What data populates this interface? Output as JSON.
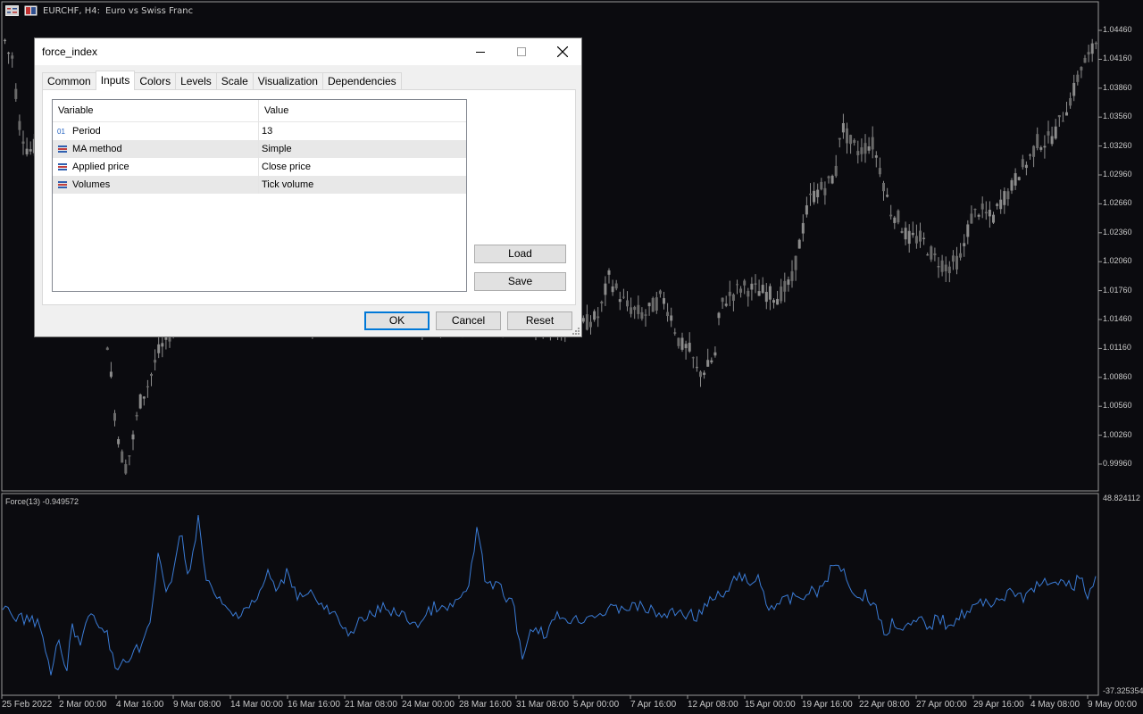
{
  "chart": {
    "symbol_label": "EURCHF, H4:",
    "description": "Euro vs Swiss Franc",
    "price_labels": [
      "1.04460",
      "1.04160",
      "1.03860",
      "1.03560",
      "1.03260",
      "1.02960",
      "1.02660",
      "1.02360",
      "1.02060",
      "1.01760",
      "1.01460",
      "1.01160",
      "1.00860",
      "1.00560",
      "1.00260",
      "0.99960"
    ],
    "date_labels": [
      "25 Feb 2022",
      "2 Mar 00:00",
      "4 Mar 16:00",
      "9 Mar 08:00",
      "14 Mar 00:00",
      "16 Mar 16:00",
      "21 Mar 08:00",
      "24 Mar 00:00",
      "28 Mar 16:00",
      "31 Mar 08:00",
      "5 Apr 00:00",
      "7 Apr 16:00",
      "12 Apr 08:00",
      "15 Apr 00:00",
      "19 Apr 16:00",
      "22 Apr 08:00",
      "27 Apr 00:00",
      "29 Apr 16:00",
      "4 May 08:00",
      "9 May 00:00"
    ],
    "indicator_title": "Force(13) -0.949572",
    "osc_max_label": "48.824112",
    "osc_min_label": "-37.325354",
    "colors": {
      "background": "#0b0b0f",
      "candle": "#8c8c8c",
      "force_line": "#3a7bd5",
      "grid_border": "#9a9a9a"
    }
  },
  "dialog": {
    "title": "force_index",
    "tabs": [
      {
        "label": "Common"
      },
      {
        "label": "Inputs"
      },
      {
        "label": "Colors"
      },
      {
        "label": "Levels"
      },
      {
        "label": "Scale"
      },
      {
        "label": "Visualization"
      },
      {
        "label": "Dependencies"
      }
    ],
    "active_tab": "Inputs",
    "grid": {
      "headers": {
        "variable": "Variable",
        "value": "Value"
      },
      "rows": [
        {
          "variable": "Period",
          "value": "13",
          "icon": "integer-icon"
        },
        {
          "variable": "MA method",
          "value": "Simple",
          "icon": "enum-icon"
        },
        {
          "variable": "Applied price",
          "value": "Close price",
          "icon": "enum-icon"
        },
        {
          "variable": "Volumes",
          "value": "Tick volume",
          "icon": "enum-icon"
        }
      ]
    },
    "buttons": {
      "load": "Load",
      "save": "Save",
      "ok": "OK",
      "cancel": "Cancel",
      "reset": "Reset"
    }
  }
}
